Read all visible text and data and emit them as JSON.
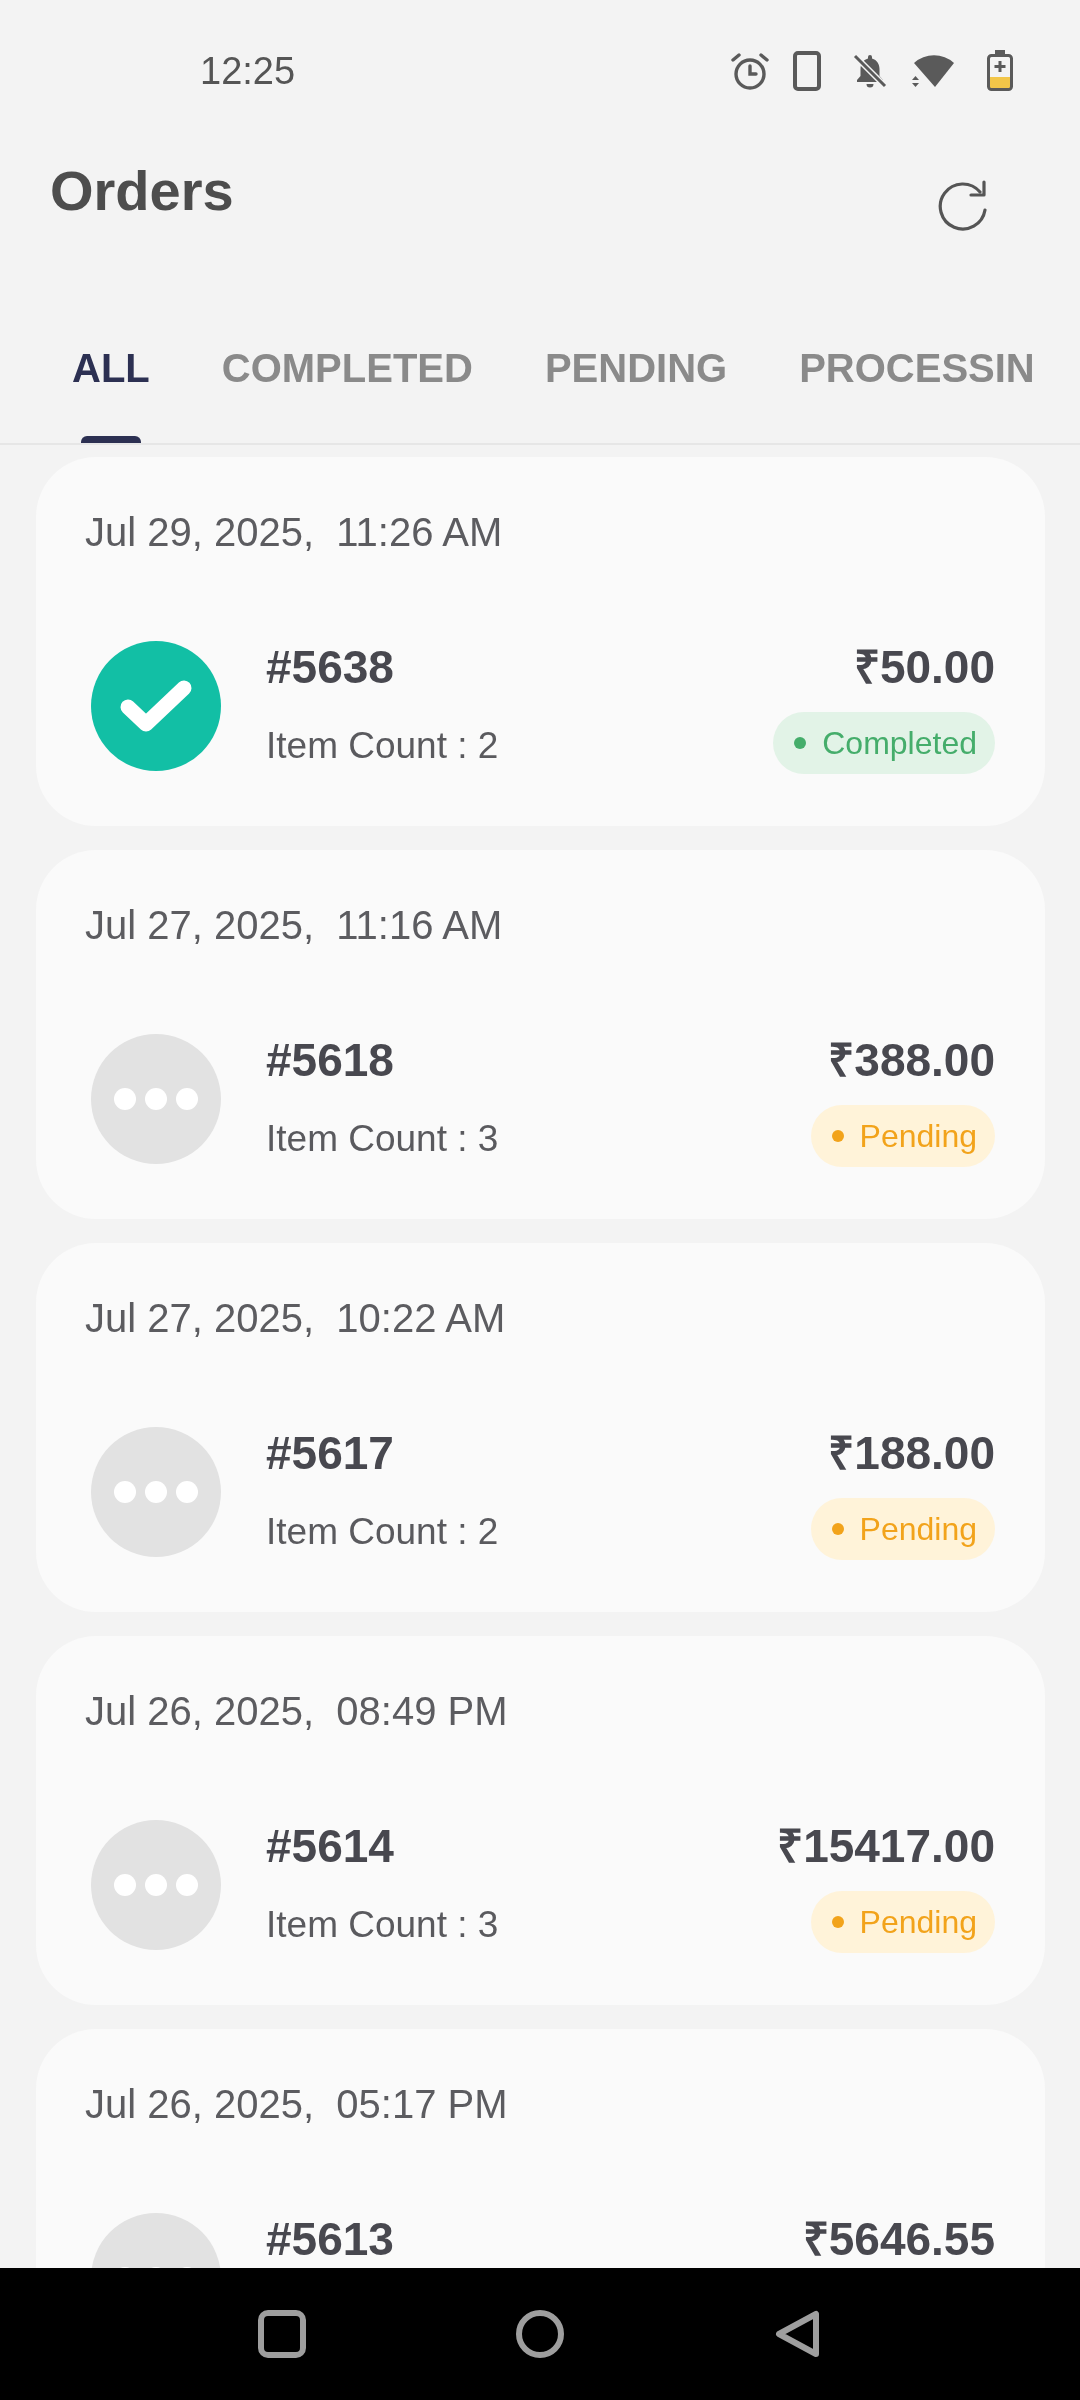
{
  "status_bar": {
    "time": "12:25"
  },
  "header": {
    "title": "Orders"
  },
  "tabs": [
    {
      "label": "ALL",
      "selected": true
    },
    {
      "label": "COMPLETED",
      "selected": false
    },
    {
      "label": "PENDING",
      "selected": false
    },
    {
      "label": "PROCESSIN",
      "selected": false
    }
  ],
  "orders": [
    {
      "date": "Jul 29, 2025,  11:26 AM",
      "number": "#5638",
      "item_count": "Item Count : 2",
      "amount": "₹50.00",
      "kind": "completed",
      "status": "Completed"
    },
    {
      "date": "Jul 27, 2025,  11:16 AM",
      "number": "#5618",
      "item_count": "Item Count : 3",
      "amount": "₹388.00",
      "kind": "pending",
      "status": "Pending"
    },
    {
      "date": "Jul 27, 2025,  10:22 AM",
      "number": "#5617",
      "item_count": "Item Count : 2",
      "amount": "₹188.00",
      "kind": "pending",
      "status": "Pending"
    },
    {
      "date": "Jul 26, 2025,  08:49 PM",
      "number": "#5614",
      "item_count": "Item Count : 3",
      "amount": "₹15417.00",
      "kind": "pending",
      "status": "Pending"
    },
    {
      "date": "Jul 26, 2025,  05:17 PM",
      "number": "#5613",
      "amount": "₹5646.55",
      "kind": "pending"
    }
  ]
}
